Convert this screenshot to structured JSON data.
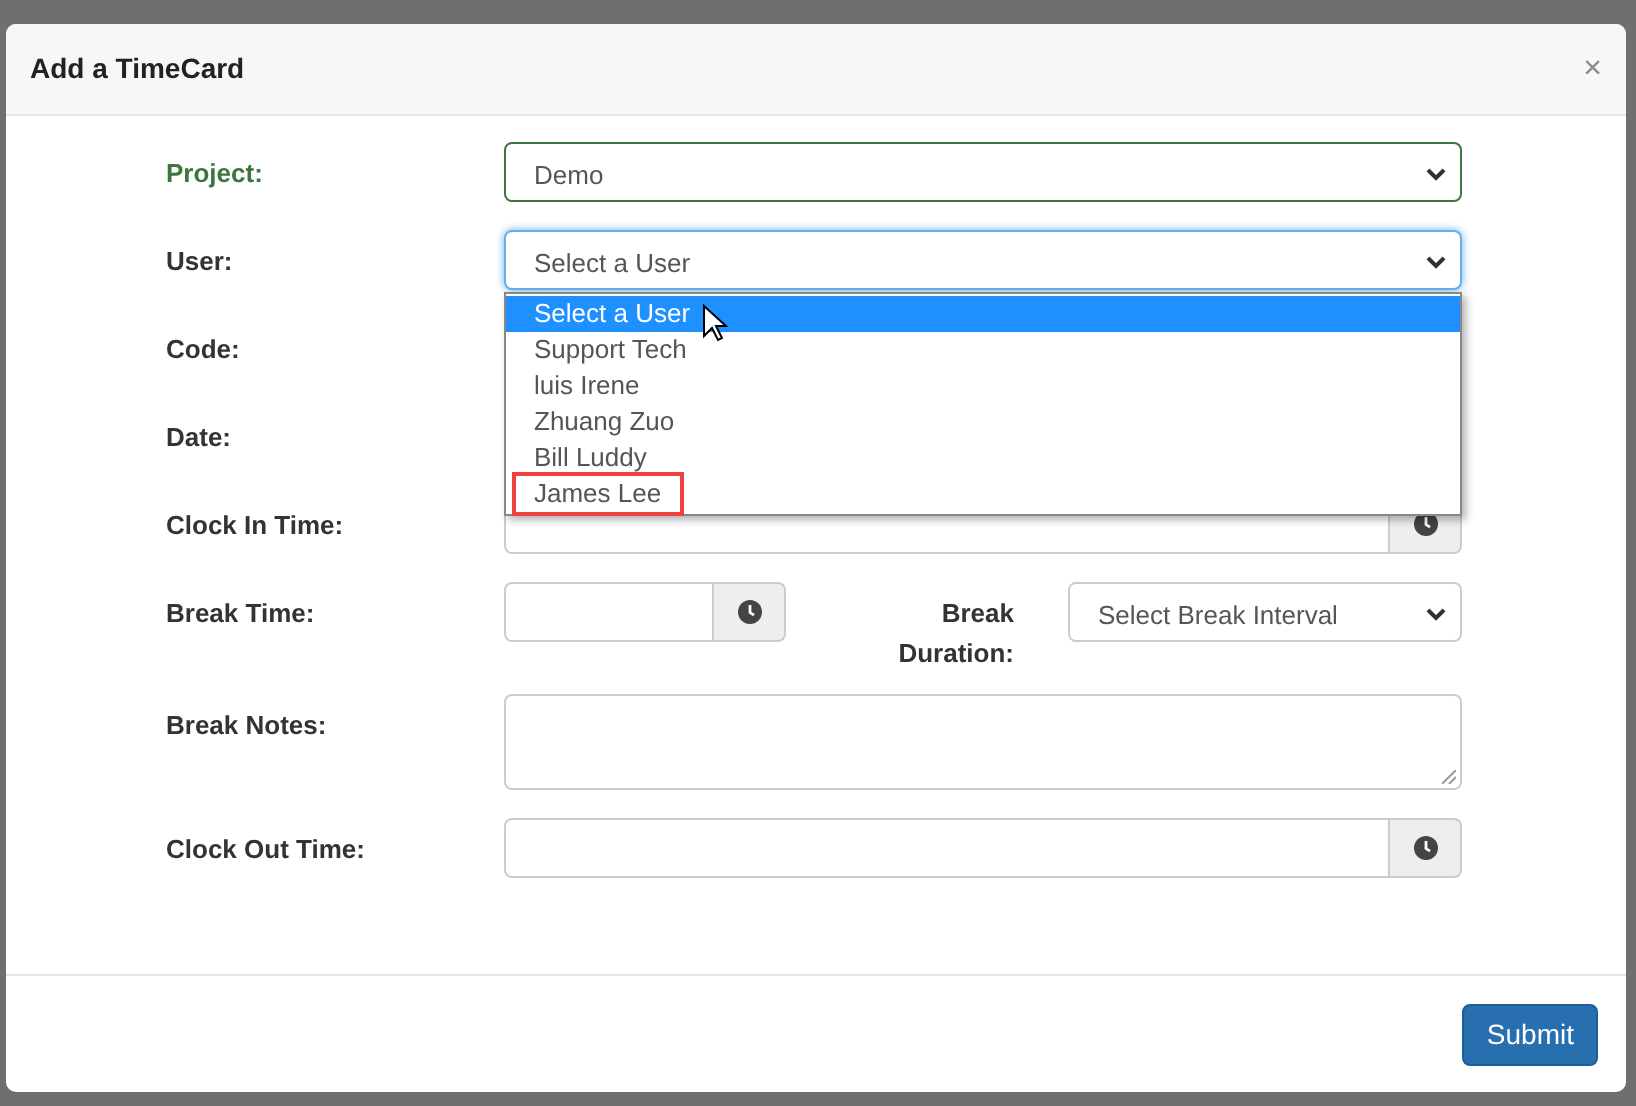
{
  "dialog": {
    "title": "Add a TimeCard",
    "close": "×"
  },
  "fields": [
    {
      "kind": "select",
      "label": "Project:",
      "value": "Demo",
      "valid": true,
      "focused": false
    },
    {
      "kind": "select",
      "label": "User:",
      "value": "Select a User",
      "valid": false,
      "focused": true,
      "dropdown": [
        {
          "label": "Select a User",
          "selected": true,
          "highlighted": false
        },
        {
          "label": "Support Tech",
          "selected": false,
          "highlighted": false
        },
        {
          "label": "luis Irene",
          "selected": false,
          "highlighted": false
        },
        {
          "label": "Zhuang Zuo",
          "selected": false,
          "highlighted": false
        },
        {
          "label": "Bill Luddy",
          "selected": false,
          "highlighted": false
        },
        {
          "label": "James Lee",
          "selected": false,
          "highlighted": true
        }
      ]
    },
    {
      "kind": "covered",
      "label": "Code:"
    },
    {
      "kind": "covered",
      "label": "Date:"
    },
    {
      "kind": "time",
      "label": "Clock In Time:"
    },
    {
      "kind": "split",
      "label": "Break Time:",
      "second_label": "Break Duration:",
      "second_value": "Select Break Interval"
    },
    {
      "kind": "textarea",
      "label": "Break Notes:"
    },
    {
      "kind": "time",
      "label": "Clock Out Time:"
    }
  ],
  "submit": "Submit"
}
